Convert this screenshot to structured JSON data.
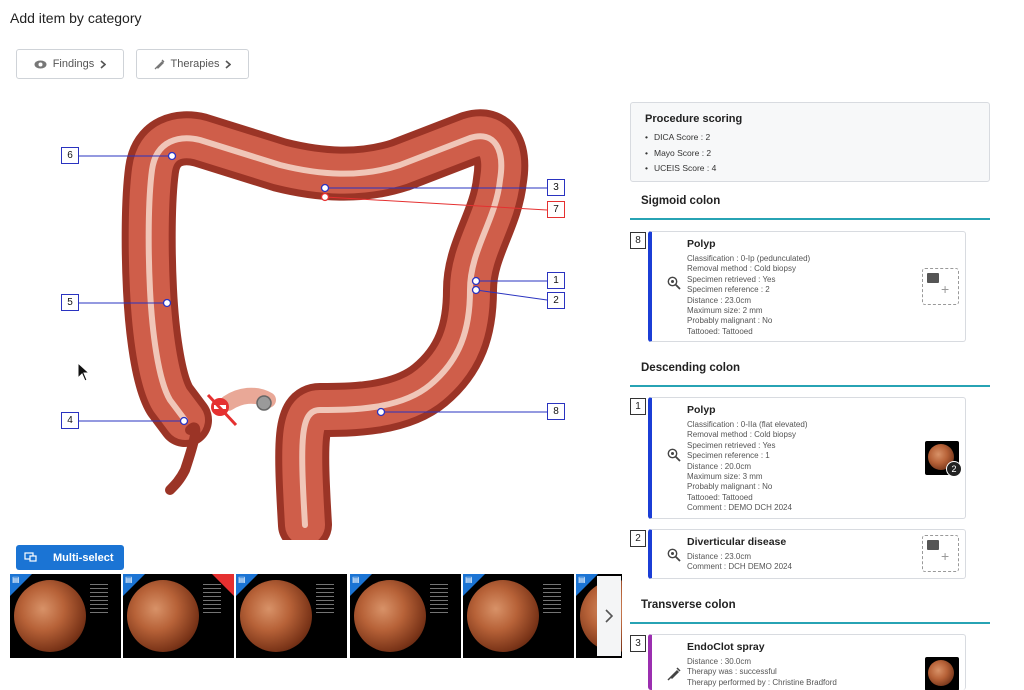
{
  "page": {
    "title": "Add item by category"
  },
  "category_buttons": [
    {
      "label": "Findings",
      "icon": "eye-icon"
    },
    {
      "label": "Therapies",
      "icon": "syringe-icon"
    }
  ],
  "anatomy": {
    "markers": [
      "6",
      "3",
      "7",
      "1",
      "2",
      "5",
      "4",
      "8"
    ]
  },
  "multi_select": {
    "label": "Multi-select",
    "icon": "monitor-icon"
  },
  "thumbnails": {
    "count": 6,
    "flags": [
      "document-icon",
      "document-icon",
      "document-icon",
      "document-icon",
      "document-icon",
      "document-icon"
    ],
    "flagged_red": [
      false,
      true,
      false,
      false,
      false,
      false
    ]
  },
  "scoring": {
    "title": "Procedure scoring",
    "items": [
      "DICA Score : 2",
      "Mayo Score : 2",
      "UCEIS Score : 4"
    ]
  },
  "sections": [
    {
      "title": "Sigmoid colon",
      "items": [
        {
          "number": "8",
          "name": "Polyp",
          "details": [
            "Classification : 0-Ip (pedunculated)",
            "Removal method : Cold biopsy",
            "Specimen retrieved : Yes",
            "Specimen reference : 2",
            "Distance : 23.0cm",
            "Maximum size: 2 mm",
            "Probably malignant : No",
            "Tattooed: Tattooed"
          ]
        }
      ]
    },
    {
      "title": "Descending colon",
      "items": [
        {
          "number": "1",
          "name": "Polyp",
          "details": [
            "Classification : 0-IIa (flat elevated)",
            "Removal method : Cold biopsy",
            "Specimen retrieved : Yes",
            "Specimen reference : 1",
            "Distance : 20.0cm",
            "Maximum size: 3 mm",
            "Probably malignant : No",
            "Tattooed: Tattooed",
            "Comment : DEMO DCH 2024"
          ],
          "image_count": "2"
        },
        {
          "number": "2",
          "name": "Diverticular disease",
          "details": [
            "Distance : 23.0cm",
            "Comment : DCH DEMO 2024"
          ]
        }
      ]
    },
    {
      "title": "Transverse colon",
      "items": [
        {
          "number": "3",
          "name": "EndoClot spray",
          "details": [
            "Distance : 30.0cm",
            "Therapy was : successful",
            "Therapy performed by : Christine Bradford"
          ]
        }
      ]
    }
  ],
  "colors": {
    "accent": "#1b74d4",
    "finding_bar": "#1b3ed6",
    "therapy_bar": "#9b2fb0",
    "section_line": "#27a3b4"
  }
}
